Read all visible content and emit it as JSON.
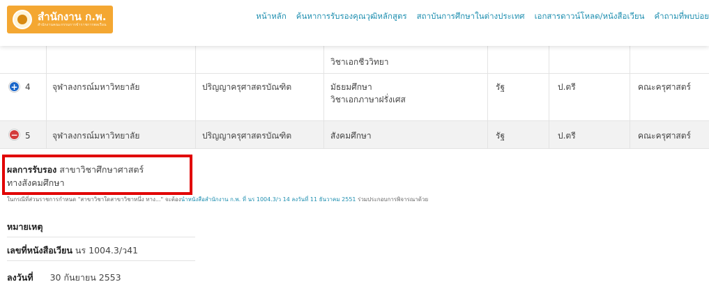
{
  "header": {
    "logo_main": "สำนักงาน ก.พ.",
    "logo_sub": "สำนักงานคณะกรรมการข้าราชการพลเรือน",
    "nav": [
      "หน้าหลัก",
      "ค้นหาการรับรองคุณวุฒิหลักสูตร",
      "สถาบันการศึกษาในต่างประเทศ",
      "เอกสารดาวน์โหลด/หนังสือเวียน",
      "คำถามที่พบบ่อย"
    ]
  },
  "table": {
    "prev_row": {
      "major": "วิชาเอกชีววิทยา"
    },
    "rows": [
      {
        "no": "4",
        "university": "จุฬาลงกรณ์มหาวิทยาลัย",
        "degree": "ปริญญาครุศาสตรบัณฑิต",
        "major_line1": "มัธยมศึกษา",
        "major_line2": "วิชาเอกภาษาฝรั่งเศส",
        "type": "รัฐ",
        "level": "ป.ตรี",
        "faculty": "คณะครุศาสตร์",
        "toggle": "plus"
      },
      {
        "no": "5",
        "university": "จุฬาลงกรณ์มหาวิทยาลัย",
        "degree": "ปริญญาครุศาสตรบัณฑิต",
        "major_line1": "สังคมศึกษา",
        "type": "รัฐ",
        "level": "ป.ตรี",
        "faculty": "คณะครุศาสตร์",
        "toggle": "minus"
      }
    ]
  },
  "detail": {
    "result_label": "ผลการรับรอง",
    "result_value_line1": "สาขาวิชาศึกษาศาสตร์",
    "result_value_line2": "ทางสังคมศึกษา",
    "note_prefix": "ในกรณีที่ส่วนราชการกำหนด \"สาขาวิชาใดสาขาวิชาหนึ่ง ทาง...\" จะต้อง",
    "note_link": "นำหนังสือสำนักงาน ก.พ. ที่ นร 1004.3/ว 14 ลงวันที่ 11 ธันวาคม 2551",
    "note_suffix": " ร่วมประกอบการพิจารณาด้วย",
    "remark_label": "หมายเหตุ",
    "circular_label": "เลขที่หนังสือเวียน",
    "circular_value": "นร 1004.3/ว41",
    "date_label": "ลงวันที่",
    "date_value": "30 กันยายน 2553"
  },
  "colors": {
    "accent": "#1f8fb0",
    "logo_bg": "#f4a732",
    "highlight_border": "#e10000",
    "plus_icon": "#1a66c9",
    "minus_icon": "#d33b3b"
  }
}
